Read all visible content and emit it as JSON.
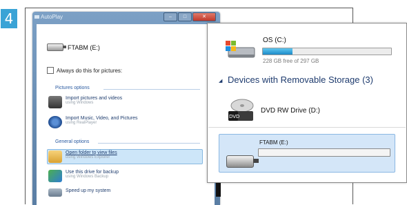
{
  "step": {
    "number": "4"
  },
  "autoplay": {
    "title": "AutoPlay",
    "drive_label": "FTABM (E:)",
    "always_label": "Always do this for pictures:",
    "pictures_section": "Pictures options",
    "general_section": "General options",
    "options": [
      {
        "main": "Import pictures and videos",
        "sub": "using Windows",
        "icon": "camera-icon"
      },
      {
        "main": "Import Music, Video, and Pictures",
        "sub": "using RealPlayer",
        "icon": "realplayer-icon"
      },
      {
        "main": "Open folder to view files",
        "sub": "using Windows Explorer",
        "icon": "folder-icon",
        "selected": true
      },
      {
        "main": "Use this drive for backup",
        "sub": "using Windows Backup",
        "icon": "backup-icon"
      },
      {
        "main": "Speed up my system",
        "sub": "",
        "icon": "speed-icon"
      }
    ],
    "buttons": {
      "minimize": "–",
      "maximize": "□",
      "close": "✕"
    }
  },
  "computer": {
    "os_drive": {
      "label": "OS (C:)",
      "free_text": "228 GB free of 297 GB",
      "used_fraction": 0.23
    },
    "group_header": "Devices with Removable Storage (3)",
    "group_arrow": "◢",
    "dvd_drive": {
      "label": "DVD RW Drive (D:)",
      "icon_text": "DVD"
    },
    "usb_drive": {
      "label": "FTABM (E:)",
      "used_fraction": 0.0
    }
  },
  "colors": {
    "accent": "#3aa3d6",
    "link": "#1f3d6e",
    "selection": "#cde6f9"
  }
}
